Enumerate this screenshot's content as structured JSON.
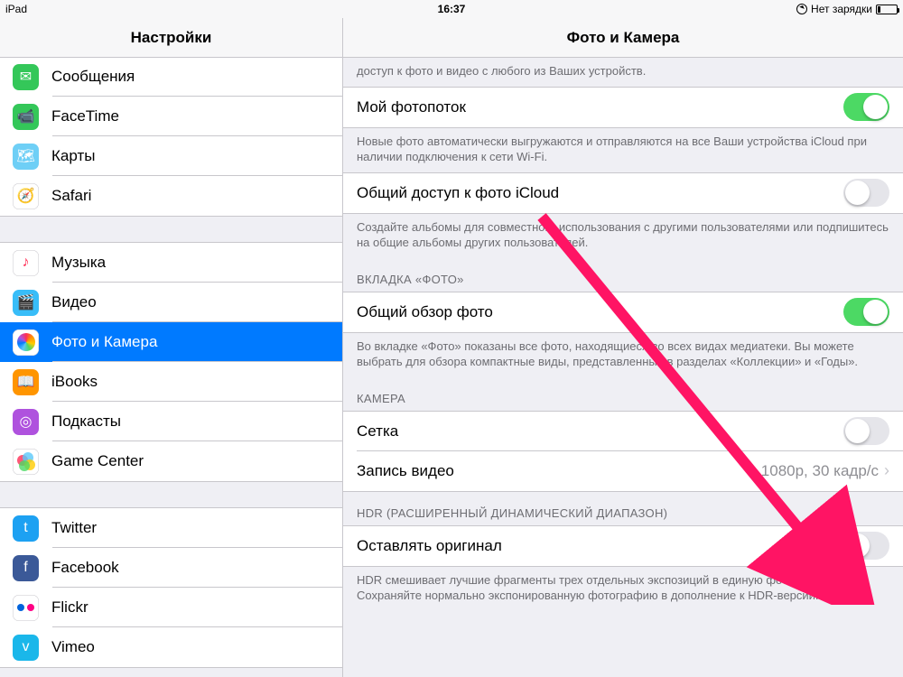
{
  "statusbar": {
    "device": "iPad",
    "time": "16:37",
    "battery_text": "Нет зарядки"
  },
  "sidebar": {
    "title": "Настройки",
    "groups": [
      {
        "items": [
          {
            "id": "messages",
            "label": "Сообщения",
            "bg": "#34c759",
            "glyph": "✉︎"
          },
          {
            "id": "facetime",
            "label": "FaceTime",
            "bg": "#34c759",
            "glyph": "📹"
          },
          {
            "id": "maps",
            "label": "Карты",
            "bg": "#6ecff6",
            "glyph": "🗺"
          },
          {
            "id": "safari",
            "label": "Safari",
            "bg": "#ffffff",
            "glyph": "🧭"
          }
        ]
      },
      {
        "items": [
          {
            "id": "music",
            "label": "Музыка",
            "bg": "#ffffff",
            "glyph": "♪",
            "glyphColor": "#ff2d55"
          },
          {
            "id": "video",
            "label": "Видео",
            "bg": "#38bdf8",
            "glyph": "🎬"
          },
          {
            "id": "photos",
            "label": "Фото и Камера",
            "bg": "#ffffff",
            "glyph": "❀",
            "selected": true
          },
          {
            "id": "ibooks",
            "label": "iBooks",
            "bg": "#ff9500",
            "glyph": "📖"
          },
          {
            "id": "podcasts",
            "label": "Подкасты",
            "bg": "#af52de",
            "glyph": "◎"
          },
          {
            "id": "gamecenter",
            "label": "Game Center",
            "bg": "#ffffff",
            "glyph": "●●"
          }
        ]
      },
      {
        "items": [
          {
            "id": "twitter",
            "label": "Twitter",
            "bg": "#1da1f2",
            "glyph": "t"
          },
          {
            "id": "facebook",
            "label": "Facebook",
            "bg": "#3b5998",
            "glyph": "f"
          },
          {
            "id": "flickr",
            "label": "Flickr",
            "bg": "#ffffff",
            "glyph": "● ●"
          },
          {
            "id": "vimeo",
            "label": "Vimeo",
            "bg": "#1ab7ea",
            "glyph": "v"
          }
        ]
      }
    ]
  },
  "detail": {
    "title": "Фото и Камера",
    "top_caption": "доступ к фото и видео с любого из Ваших устройств.",
    "stream_label": "Мой фотопоток",
    "stream_on": true,
    "stream_caption": "Новые фото автоматически выгружаются и отправляются на все Ваши устройства iCloud при наличии подключения к сети Wi-Fi.",
    "shared_label": "Общий доступ к фото iCloud",
    "shared_on": false,
    "shared_caption": "Создайте альбомы для совместного использования с другими пользователями или подпишитесь на общие альбомы других пользователей.",
    "tab_header": "Вкладка «Фото»",
    "overview_label": "Общий обзор фото",
    "overview_on": true,
    "overview_caption": "Во вкладке «Фото» показаны все фото, находящиеся во всех видах медиатеки. Вы можете выбрать для обзора компактные виды, представленные в разделах «Коллекции» и «Годы».",
    "camera_header": "Камера",
    "grid_label": "Сетка",
    "grid_on": false,
    "record_label": "Запись видео",
    "record_value": "1080p, 30 кадр/с",
    "hdr_header": "HDR (расширенный динамический диапазон)",
    "keep_label": "Оставлять оригинал",
    "keep_on": false,
    "hdr_caption": "HDR смешивает лучшие фрагменты трех отдельных экспозиций в единую фотографию. Сохраняйте нормально экспонированную фотографию в дополнение к HDR-версии."
  }
}
